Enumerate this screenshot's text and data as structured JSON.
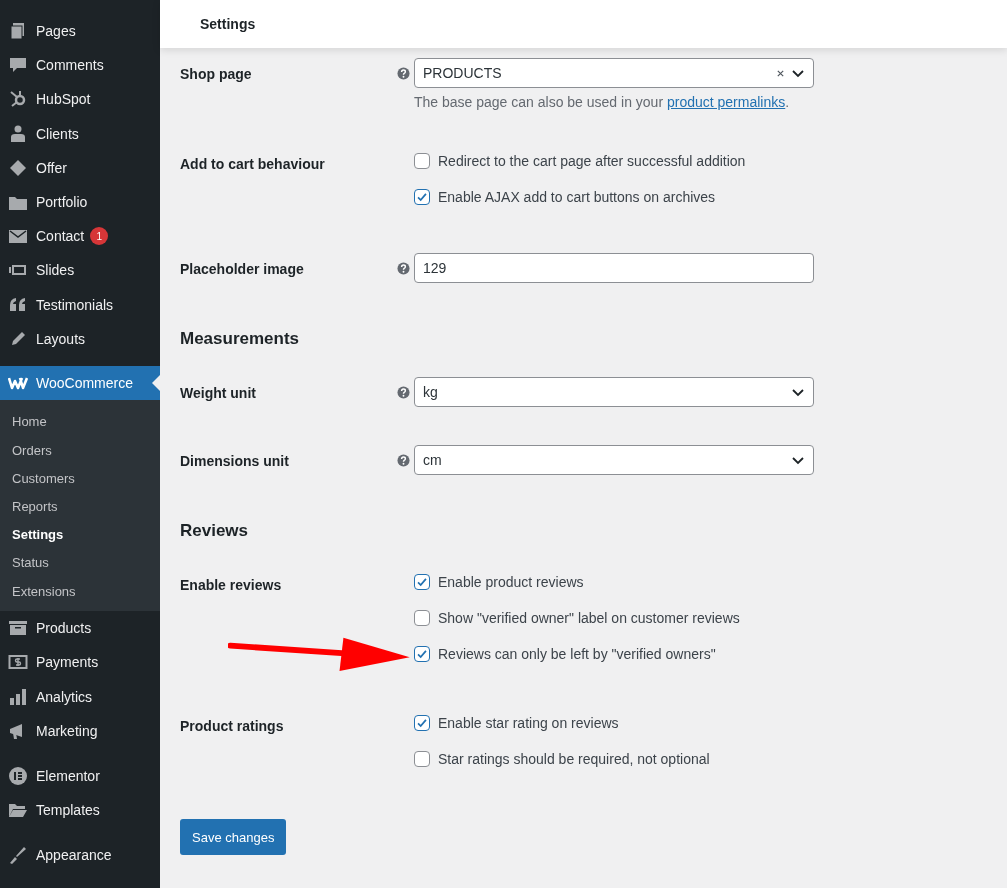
{
  "sidebar": {
    "items_top": [
      {
        "label": "Pages"
      },
      {
        "label": "Comments"
      },
      {
        "label": "HubSpot"
      },
      {
        "label": "Clients"
      },
      {
        "label": "Offer"
      },
      {
        "label": "Portfolio"
      },
      {
        "label": "Contact",
        "badge": "1"
      },
      {
        "label": "Slides"
      },
      {
        "label": "Testimonials"
      },
      {
        "label": "Layouts"
      }
    ],
    "current": {
      "label": "WooCommerce",
      "selected": true,
      "submenu": [
        {
          "label": "Home",
          "selected": false
        },
        {
          "label": "Orders",
          "selected": false
        },
        {
          "label": "Customers",
          "selected": false
        },
        {
          "label": "Reports",
          "selected": false
        },
        {
          "label": "Settings",
          "selected": true
        },
        {
          "label": "Status",
          "selected": false
        },
        {
          "label": "Extensions",
          "selected": false
        }
      ]
    },
    "groups_bottom": [
      [
        {
          "label": "Products"
        },
        {
          "label": "Payments"
        },
        {
          "label": "Analytics"
        },
        {
          "label": "Marketing"
        }
      ],
      [
        {
          "label": "Elementor"
        },
        {
          "label": "Templates"
        }
      ],
      [
        {
          "label": "Appearance"
        }
      ]
    ]
  },
  "header": {
    "title": "Settings"
  },
  "rows": [
    {
      "kind": "select",
      "label": "Shop page",
      "help": true,
      "value": "PRODUCTS",
      "clearable": true,
      "description": {
        "before": "The base page can also be used in your ",
        "link": "product permalinks",
        "after": "."
      }
    },
    {
      "kind": "checkboxes",
      "label": "Add to cart behaviour",
      "options": [
        {
          "label": "Redirect to the cart page after successful addition",
          "checked": false
        },
        {
          "label": "Enable AJAX add to cart buttons on archives",
          "checked": true
        }
      ]
    },
    {
      "kind": "text",
      "label": "Placeholder image",
      "help": true,
      "value": "129"
    },
    {
      "kind": "heading",
      "label": "Measurements"
    },
    {
      "kind": "select",
      "label": "Weight unit",
      "help": true,
      "value": "kg",
      "clearable": false
    },
    {
      "kind": "select",
      "label": "Dimensions unit",
      "help": true,
      "value": "cm",
      "clearable": false
    },
    {
      "kind": "heading",
      "label": "Reviews"
    },
    {
      "kind": "checkboxes",
      "label": "Enable reviews",
      "annotation": {
        "kind": "arrow"
      },
      "options": [
        {
          "label": "Enable product reviews",
          "checked": true
        },
        {
          "label": "Show \"verified owner\" label on customer reviews",
          "checked": false
        },
        {
          "label": "Reviews can only be left by \"verified owners\"",
          "checked": true
        }
      ]
    },
    {
      "kind": "checkboxes",
      "label": "Product ratings",
      "options": [
        {
          "label": "Enable star rating on reviews",
          "checked": true
        },
        {
          "label": "Star ratings should be required, not optional",
          "checked": false
        }
      ]
    }
  ],
  "save_button": "Save changes"
}
